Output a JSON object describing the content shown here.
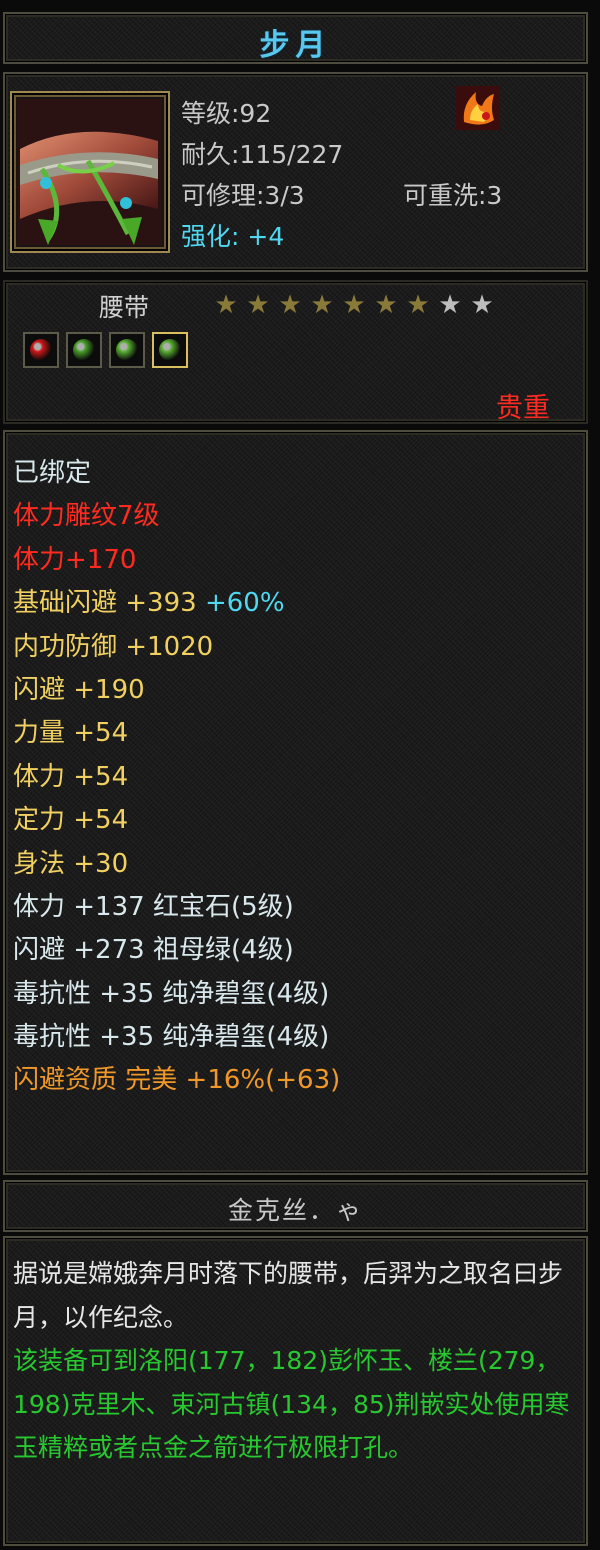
{
  "item": {
    "name": "步月",
    "icon": "belt-icon",
    "badge_icon": "flame-emblem-icon",
    "level_text": "等级:92",
    "durability_text": "耐久:115/227",
    "repairable_text": "可修理:3/3",
    "rewash_text": "可重洗:3",
    "enhance_text": "强化: +4",
    "type": "腰带",
    "stars_total": 9,
    "stars_filled": 7,
    "rarity": "贵重"
  },
  "gems": [
    {
      "name": "red-gem-icon",
      "color": "#d01818"
    },
    {
      "name": "green-gem-icon",
      "color": "#48a028"
    },
    {
      "name": "green-gem-icon",
      "color": "#58b030"
    },
    {
      "name": "green-gem-icon",
      "color": "#58b030"
    }
  ],
  "colors": {
    "white": "#d8e8ec",
    "red": "#ff2a20",
    "yellow": "#f0d060",
    "cyan": "#4fd8f0",
    "orange": "#f09828",
    "star_filled": "#8a7a3a",
    "star_empty": "#bdbdbd"
  },
  "stats": [
    [
      {
        "t": "已绑定",
        "c": "white"
      }
    ],
    [
      {
        "t": "体力雕纹7级",
        "c": "red"
      }
    ],
    [
      {
        "t": "体力+170",
        "c": "red"
      }
    ],
    [
      {
        "t": "基础闪避 +393 ",
        "c": "yellow"
      },
      {
        "t": "+60%",
        "c": "cyan"
      }
    ],
    [
      {
        "t": "内功防御 +1020",
        "c": "yellow"
      }
    ],
    [
      {
        "t": "闪避 +190",
        "c": "yellow"
      }
    ],
    [
      {
        "t": "力量 +54",
        "c": "yellow"
      }
    ],
    [
      {
        "t": "体力 +54",
        "c": "yellow"
      }
    ],
    [
      {
        "t": "定力 +54",
        "c": "yellow"
      }
    ],
    [
      {
        "t": "身法 +30",
        "c": "yellow"
      }
    ],
    [
      {
        "t": "体力 +137 红宝石(5级)",
        "c": "white"
      }
    ],
    [
      {
        "t": "闪避 +273 祖母绿(4级)",
        "c": "white"
      }
    ],
    [
      {
        "t": "毒抗性 +35 纯净碧玺(4级)",
        "c": "white"
      }
    ],
    [
      {
        "t": "毒抗性 +35 纯净碧玺(4级)",
        "c": "white"
      }
    ],
    [
      {
        "t": "闪避资质  完美 +16%(+63)",
        "c": "orange"
      }
    ]
  ],
  "maker": "金克丝．ゃ",
  "description": {
    "lore": "据说是嫦娥奔月时落下的腰带，后羿为之取名曰步月，以作纪念。",
    "hint": "该装备可到洛阳(177，182)彭怀玉、楼兰(279，198)克里木、束河古镇(134，85)荆嵌实处使用寒玉精粹或者点金之箭进行极限打孔。"
  }
}
